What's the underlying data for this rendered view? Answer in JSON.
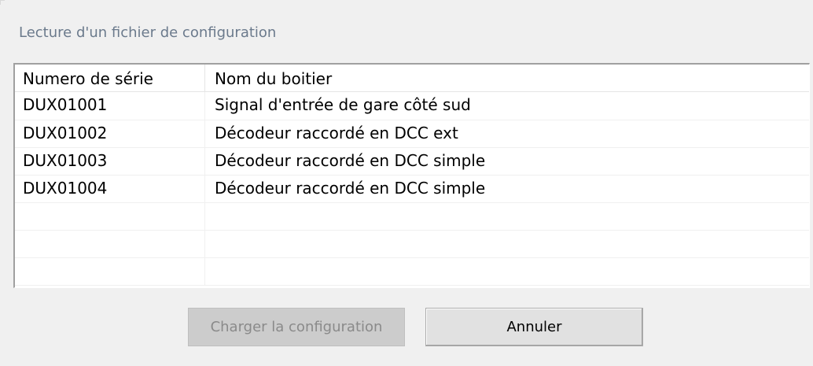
{
  "dialog": {
    "title": "Lecture d'un fichier de configuration"
  },
  "list": {
    "columns": [
      "Numero de série",
      "Nom du boitier"
    ],
    "rows": [
      {
        "serial": "DUX01001",
        "name": "Signal d'entrée de gare côté sud"
      },
      {
        "serial": "DUX01002",
        "name": "Décodeur raccordé en DCC ext"
      },
      {
        "serial": "DUX01003",
        "name": "Décodeur raccordé en DCC simple"
      },
      {
        "serial": "DUX01004",
        "name": "Décodeur raccordé en DCC simple"
      },
      {
        "serial": "",
        "name": ""
      },
      {
        "serial": "",
        "name": ""
      },
      {
        "serial": "",
        "name": ""
      }
    ]
  },
  "buttons": {
    "load_label": "Charger la configuration",
    "load_enabled": false,
    "cancel_label": "Annuler"
  }
}
